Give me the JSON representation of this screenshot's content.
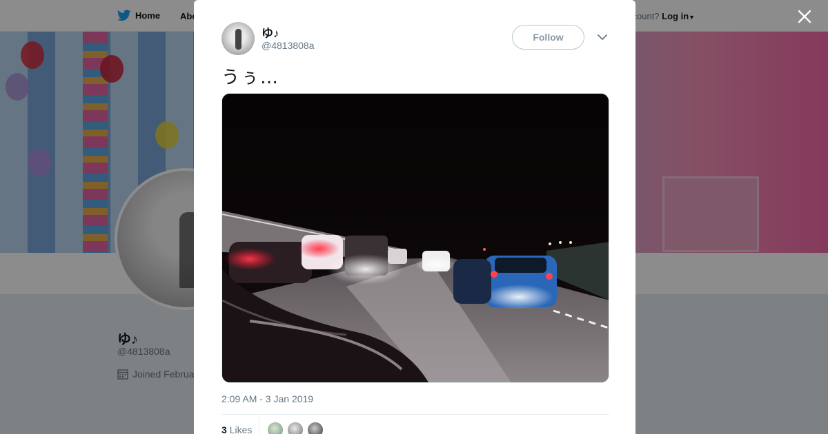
{
  "colors": {
    "twitter_blue": "#1da1f2",
    "overlay": "rgba(0,0,0,0.45)",
    "text_primary": "#14171a",
    "text_secondary": "#657786"
  },
  "background_page": {
    "nav": {
      "home_icon": "twitter-bird-icon",
      "home_label": "Home",
      "about_label": "Abo",
      "account_prompt": "ccount?",
      "login_label": "Log in",
      "login_icon": "caret-down-icon"
    },
    "profile": {
      "name": "ゆ♪",
      "handle": "@4813808a",
      "joined_text": "Joined Februa",
      "joined_icon": "calendar-icon"
    }
  },
  "modal": {
    "close_icon": "close-icon",
    "tweet": {
      "author_name": "ゆ♪",
      "author_handle": "@4813808a",
      "follow_label": "Follow",
      "menu_icon": "chevron-down-icon",
      "text": "うぅ…",
      "photo_description_icon": "tweet-photo",
      "timestamp": "2:09 AM - 3 Jan 2019",
      "likes_count": "3",
      "likes_label": "Likes",
      "likers": [
        "liker-avatar-1",
        "liker-avatar-2",
        "liker-avatar-3"
      ]
    }
  }
}
